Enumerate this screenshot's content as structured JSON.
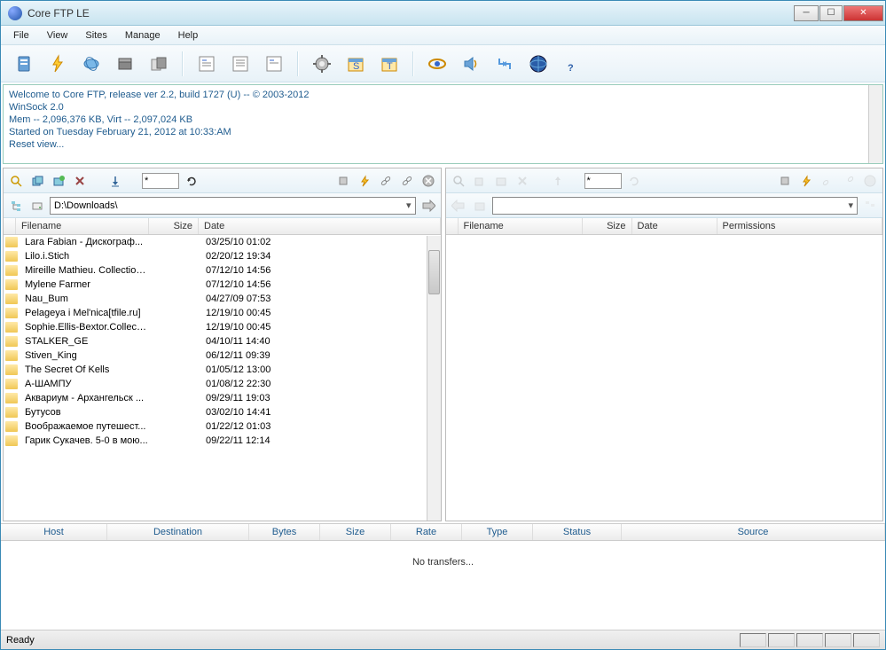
{
  "title": "Core FTP LE",
  "menu": [
    "File",
    "View",
    "Sites",
    "Manage",
    "Help"
  ],
  "log": [
    "Welcome to Core FTP, release ver 2.2, build 1727 (U) -- © 2003-2012",
    "WinSock 2.0",
    "Mem -- 2,096,376 KB, Virt -- 2,097,024 KB",
    "Started on Tuesday February 21, 2012 at 10:33:AM",
    "Reset view..."
  ],
  "local": {
    "filter": "*",
    "path": "D:\\Downloads\\",
    "columns": [
      "Filename",
      "Size",
      "Date"
    ],
    "files": [
      {
        "name": "Lara Fabian - Дискограф...",
        "size": "",
        "date": "03/25/10  01:02"
      },
      {
        "name": "Lilo.i.Stich",
        "size": "",
        "date": "02/20/12  19:34"
      },
      {
        "name": "Mireille Mathieu. Collection....",
        "size": "",
        "date": "07/12/10  14:56"
      },
      {
        "name": "Mylene Farmer",
        "size": "",
        "date": "07/12/10  14:56"
      },
      {
        "name": "Nau_Bum",
        "size": "",
        "date": "04/27/09  07:53"
      },
      {
        "name": "Pelageya i Mel'nica[tfile.ru]",
        "size": "",
        "date": "12/19/10  00:45"
      },
      {
        "name": "Sophie.Ellis-Bextor.Collecti...",
        "size": "",
        "date": "12/19/10  00:45"
      },
      {
        "name": "STALKER_GE",
        "size": "",
        "date": "04/10/11  14:40"
      },
      {
        "name": "Stiven_King",
        "size": "",
        "date": "06/12/11  09:39"
      },
      {
        "name": "The Secret Of Kells",
        "size": "",
        "date": "01/05/12  13:00"
      },
      {
        "name": "А-ШАМПУ",
        "size": "",
        "date": "01/08/12  22:30"
      },
      {
        "name": "Аквариум - Архангельск ...",
        "size": "",
        "date": "09/29/11  19:03"
      },
      {
        "name": "Бутусов",
        "size": "",
        "date": "03/02/10  14:41"
      },
      {
        "name": "Воображаемое путешест...",
        "size": "",
        "date": "01/22/12  01:03"
      },
      {
        "name": "Гарик Сукачев. 5-0 в мою...",
        "size": "",
        "date": "09/22/11  12:14"
      }
    ]
  },
  "remote": {
    "filter": "*",
    "path": "",
    "columns": [
      "Filename",
      "Size",
      "Date",
      "Permissions"
    ]
  },
  "transfer_columns": [
    "Host",
    "Destination",
    "Bytes",
    "Size",
    "Rate",
    "Type",
    "Status",
    "Source"
  ],
  "transfer_empty": "No transfers...",
  "status": "Ready"
}
